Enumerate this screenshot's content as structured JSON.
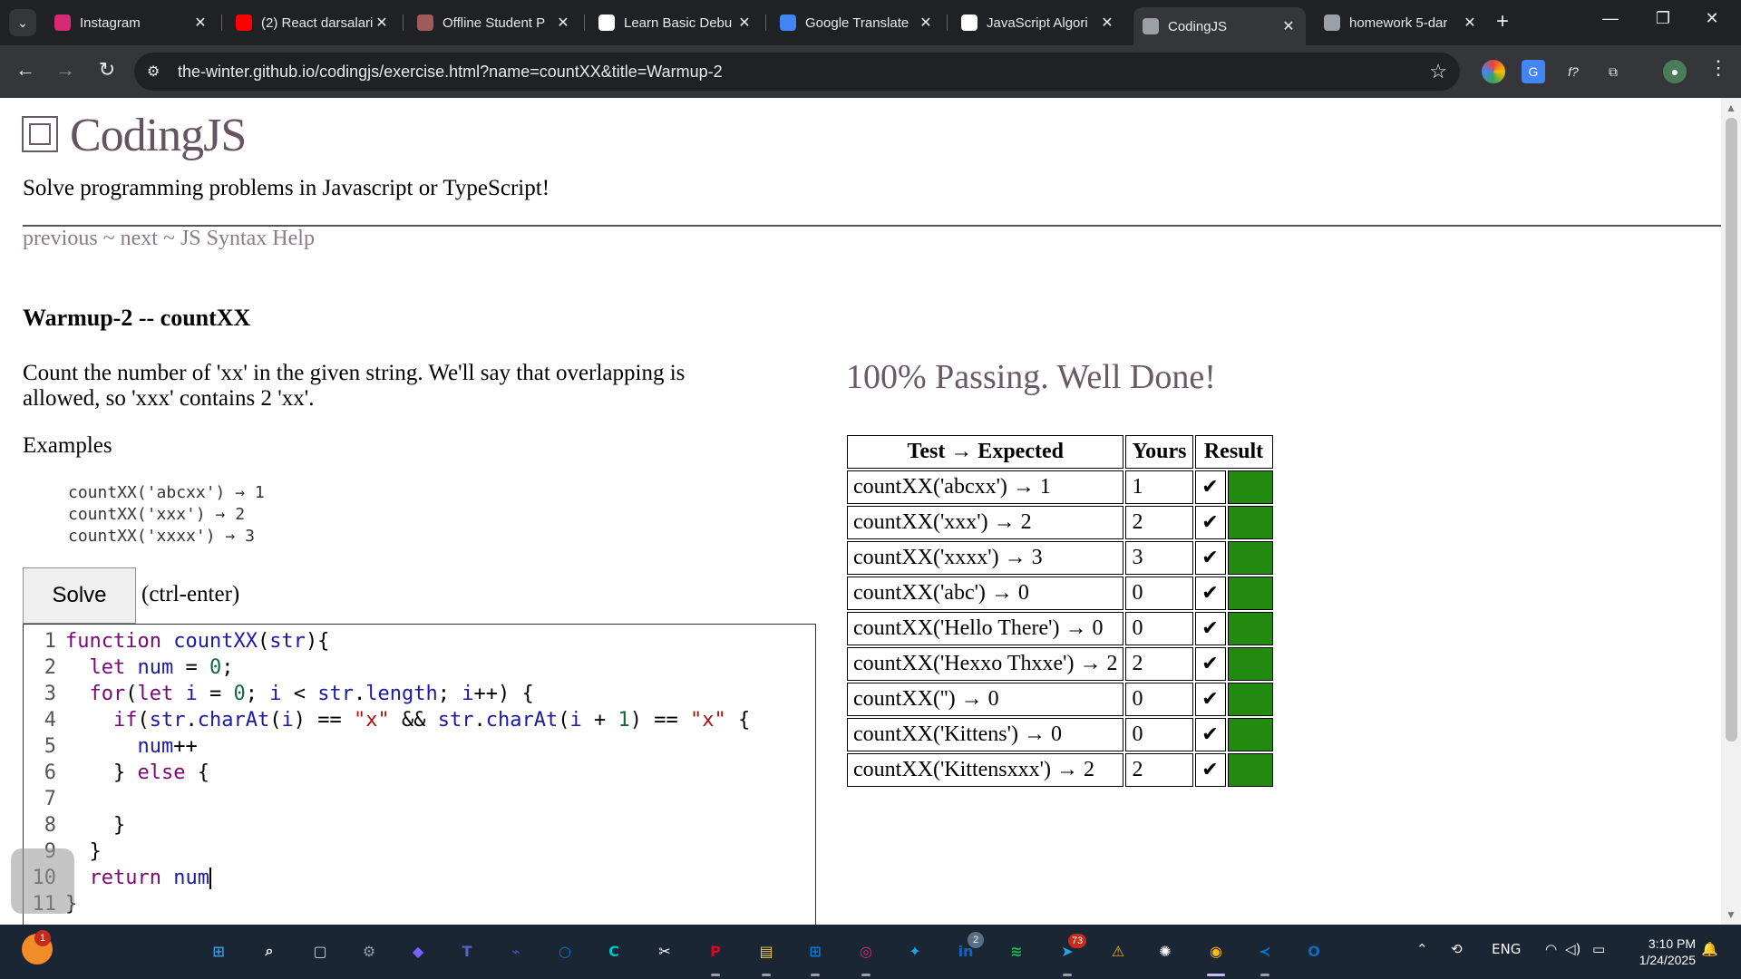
{
  "browser": {
    "tabs": [
      {
        "title": "Instagram",
        "favicon": "instagram-icon",
        "color": "#d62976"
      },
      {
        "title": "(2) React darsalari",
        "favicon": "youtube-icon",
        "color": "#ff0000"
      },
      {
        "title": "Offline Student P",
        "favicon": "heart-icon",
        "color": "#a05a5a"
      },
      {
        "title": "Learn Basic Debu",
        "favicon": "freecodecamp-icon",
        "color": "#ffffff"
      },
      {
        "title": "Google Translate",
        "favicon": "translate-icon",
        "color": "#4285f4"
      },
      {
        "title": "JavaScript Algori",
        "favicon": "freecodecamp-icon",
        "color": "#ffffff"
      },
      {
        "title": "CodingJS",
        "favicon": "globe-icon",
        "color": "#9aa0a6"
      },
      {
        "title": "homework 5-dar",
        "favicon": "globe-icon",
        "color": "#9aa0a6"
      }
    ],
    "active_tab": 6,
    "url": "the-winter.github.io/codingjs/exercise.html?name=countXX&title=Warmup-2"
  },
  "site": {
    "title": "CodingJS",
    "tagline": "Solve programming problems in Javascript or TypeScript!",
    "nav": {
      "previous": "previous",
      "sep1": " ~ ",
      "next": "next",
      "sep2": " ~ ",
      "help": "JS Syntax Help"
    }
  },
  "problem": {
    "title": "Warmup-2 -- countXX",
    "description": "Count the number of 'xx' in the given string. We'll say that overlapping is allowed, so 'xxx' contains 2 'xx'.",
    "examples_label": "Examples",
    "examples": [
      "countXX('abcxx') → 1",
      "countXX('xxx') → 2",
      "countXX('xxxx') → 3"
    ]
  },
  "solve": {
    "label": "Solve",
    "hint": "(ctrl-enter)"
  },
  "code_lines": [
    "function countXX(str){",
    "  let num = 0;",
    "  for(let i = 0; i < str.length; i++) {",
    "    if(str.charAt(i) == \"x\" && str.charAt(i + 1) == \"x\" {",
    "      num++",
    "    } else {",
    "",
    "    }",
    "  }",
    "  return num",
    "}"
  ],
  "results": {
    "message": "100% Passing. Well Done!",
    "headers": [
      "Test → Expected",
      "Yours",
      "Result"
    ],
    "rows": [
      {
        "test": "countXX('abcxx') → 1",
        "yours": "1",
        "mark": "✔"
      },
      {
        "test": "countXX('xxx') → 2",
        "yours": "2",
        "mark": "✔"
      },
      {
        "test": "countXX('xxxx') → 3",
        "yours": "3",
        "mark": "✔"
      },
      {
        "test": "countXX('abc') → 0",
        "yours": "0",
        "mark": "✔"
      },
      {
        "test": "countXX('Hello There') → 0",
        "yours": "0",
        "mark": "✔"
      },
      {
        "test": "countXX('Hexxo Thxxe') → 2",
        "yours": "2",
        "mark": "✔"
      },
      {
        "test": "countXX('') → 0",
        "yours": "0",
        "mark": "✔"
      },
      {
        "test": "countXX('Kittens') → 0",
        "yours": "0",
        "mark": "✔"
      },
      {
        "test": "countXX('Kittensxxx') → 2",
        "yours": "2",
        "mark": "✔"
      }
    ],
    "pass_color": "#228b0f"
  },
  "taskbar": {
    "apps": [
      {
        "name": "start-icon",
        "color": "#3a96dd"
      },
      {
        "name": "search-icon",
        "color": "#ffffff"
      },
      {
        "name": "task-view-icon",
        "color": "#cfd8dc"
      },
      {
        "name": "settings-icon",
        "color": "#8a9bb0"
      },
      {
        "name": "copilot-icon",
        "color": "#7b61ff"
      },
      {
        "name": "teams-icon",
        "color": "#5b5fc7"
      },
      {
        "name": "code-editor-icon",
        "color": "#3f51b5"
      },
      {
        "name": "cortana-icon",
        "color": "#0078d4"
      },
      {
        "name": "canva-icon",
        "color": "#00c4cc"
      },
      {
        "name": "capcut-icon",
        "color": "#ffffff"
      },
      {
        "name": "pinterest-icon",
        "color": "#e60023"
      },
      {
        "name": "file-explorer-icon",
        "color": "#f2c94c"
      },
      {
        "name": "store-icon",
        "color": "#0078d4"
      },
      {
        "name": "instagram-icon",
        "color": "#d62976"
      },
      {
        "name": "twitter-icon",
        "color": "#1da1f2"
      },
      {
        "name": "linkedin-icon",
        "color": "#0a66c2"
      },
      {
        "name": "spotify-icon",
        "color": "#1db954"
      },
      {
        "name": "telegram-icon",
        "color": "#2aa3df"
      },
      {
        "name": "arduino-icon",
        "color": "#f5b400"
      },
      {
        "name": "chatgpt-icon",
        "color": "#ffffff"
      },
      {
        "name": "chrome-icon",
        "color": "#fbbc04"
      },
      {
        "name": "vscode-icon",
        "color": "#0078d4"
      },
      {
        "name": "outlook-icon",
        "color": "#0f6cbd"
      }
    ],
    "badges": {
      "weather": "1",
      "linkedin": "2",
      "telegram": "73"
    },
    "language": "ENG",
    "time": "3:10 PM",
    "date": "1/24/2025"
  }
}
